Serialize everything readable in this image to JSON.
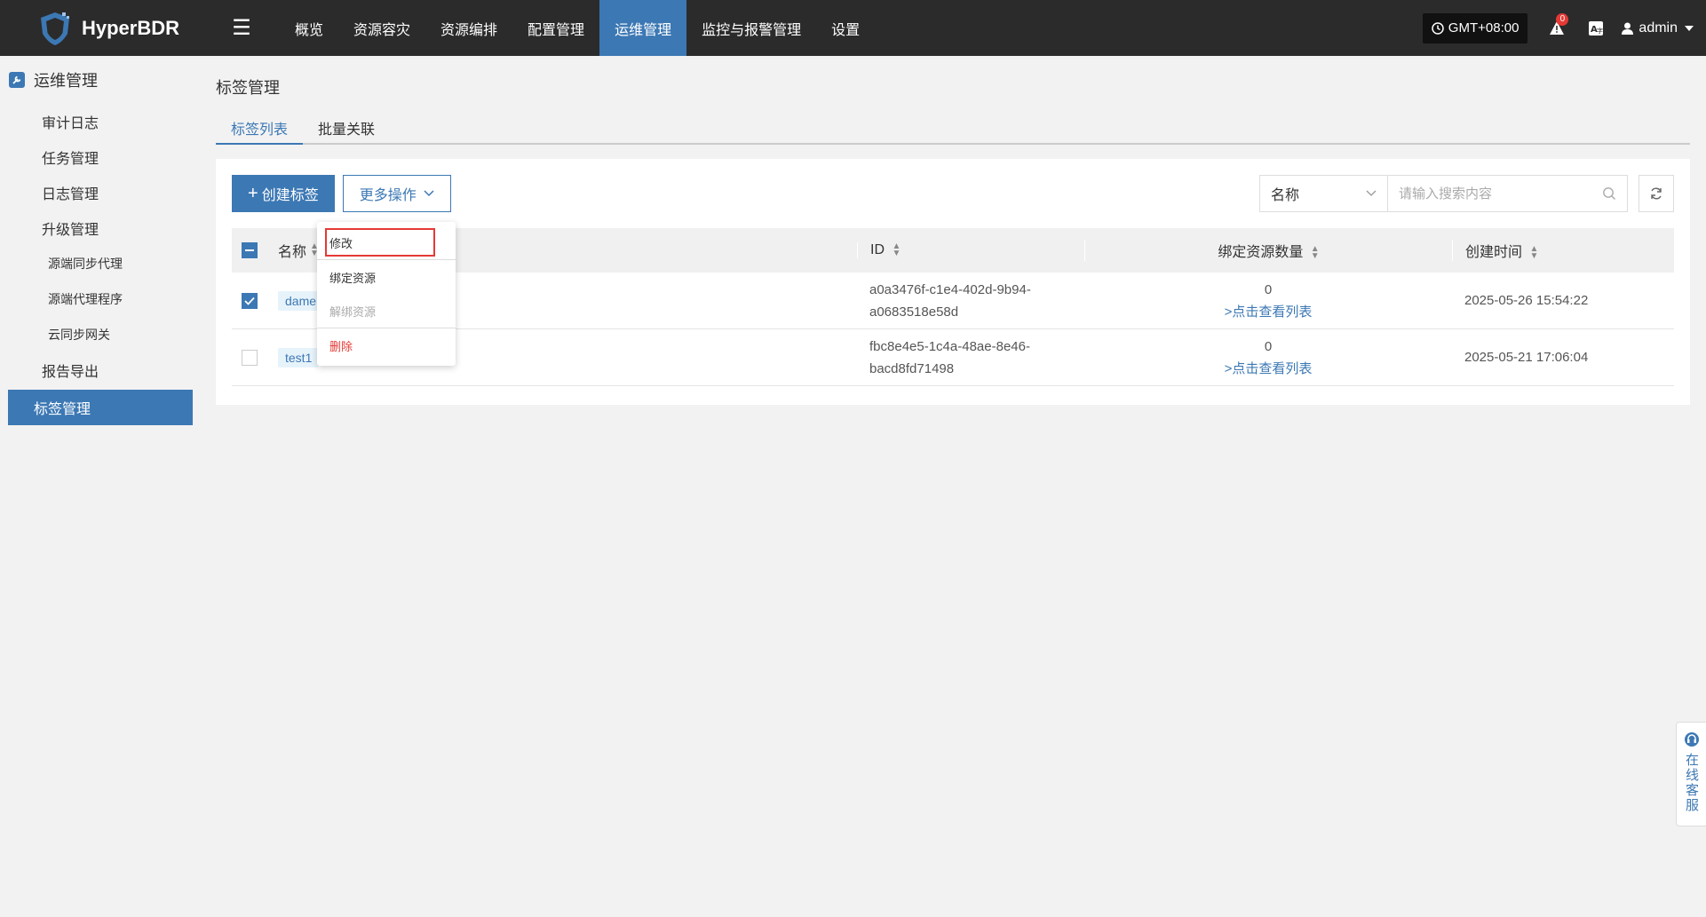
{
  "brand": {
    "name": "HyperBDR",
    "color": "#3c78b4"
  },
  "topnav": {
    "items": [
      {
        "label": "概览"
      },
      {
        "label": "资源容灾"
      },
      {
        "label": "资源编排"
      },
      {
        "label": "配置管理"
      },
      {
        "label": "运维管理",
        "active": true
      },
      {
        "label": "监控与报警管理"
      },
      {
        "label": "设置"
      }
    ],
    "timezone": "GMT+08:00",
    "alarm_count": "0",
    "user": "admin"
  },
  "sidebar": {
    "section_title": "运维管理",
    "items": [
      {
        "label": "审计日志"
      },
      {
        "label": "任务管理"
      },
      {
        "label": "日志管理"
      },
      {
        "label": "升级管理"
      },
      {
        "label": "源端同步代理"
      },
      {
        "label": "源端代理程序"
      },
      {
        "label": "云同步网关"
      },
      {
        "label": "报告导出"
      },
      {
        "label": "标签管理"
      }
    ]
  },
  "page": {
    "title": "标签管理",
    "tabs": [
      {
        "label": "标签列表"
      },
      {
        "label": "批量关联"
      }
    ]
  },
  "toolbar": {
    "create_label": "创建标签",
    "more_label": "更多操作",
    "search_field": "名称",
    "search_placeholder": "请输入搜索内容"
  },
  "dropdown": {
    "items": [
      {
        "label": "修改"
      },
      {
        "label": "绑定资源"
      },
      {
        "label": "解绑资源"
      },
      {
        "label": "删除"
      }
    ]
  },
  "table": {
    "columns": {
      "name": "名称",
      "id": "ID",
      "count": "绑定资源数量",
      "time": "创建时间"
    },
    "rows": [
      {
        "name": "dame",
        "id_line1": "a0a3476f-c1e4-402d-9b94-",
        "id_line2": "a0683518e58d",
        "count": "0",
        "link": ">点击查看列表",
        "time": "2025-05-26 15:54:22",
        "checked": true
      },
      {
        "name": "test1",
        "id_line1": "fbc8e4e5-1c4a-48ae-8e46-",
        "id_line2": "bacd8fd71498",
        "count": "0",
        "link": ">点击查看列表",
        "time": "2025-05-21 17:06:04",
        "checked": false
      }
    ]
  },
  "service": {
    "label": "在线客服"
  }
}
